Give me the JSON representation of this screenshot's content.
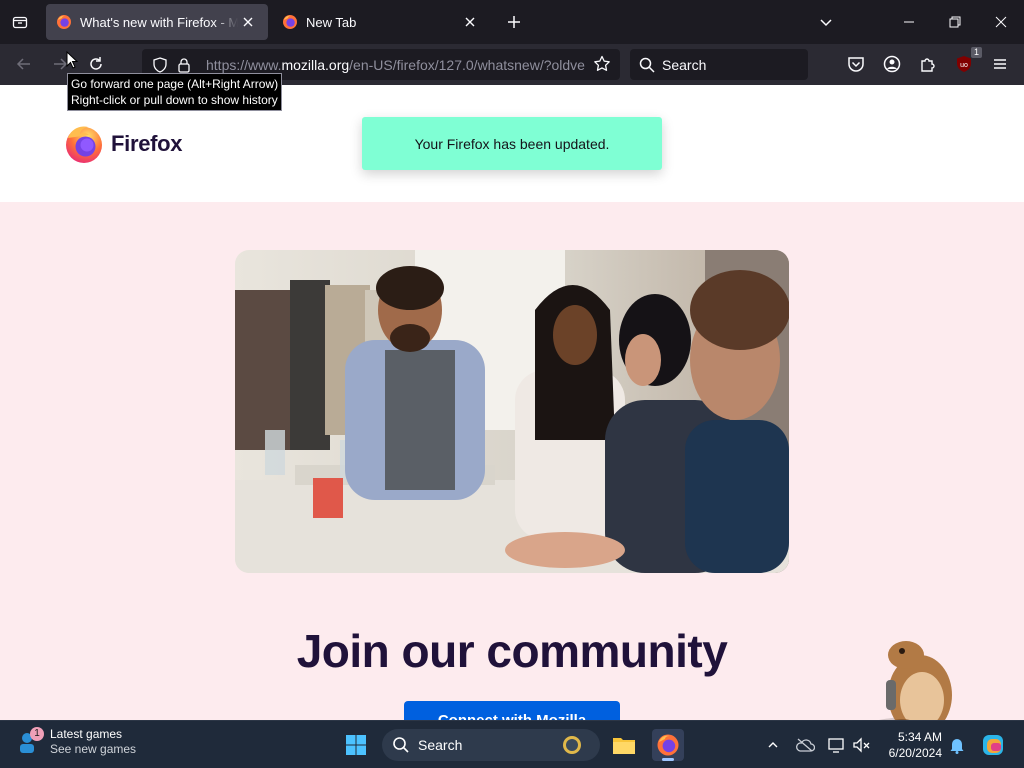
{
  "browser": {
    "tabs": [
      {
        "title": "What's new with Firefox - More",
        "active": true
      },
      {
        "title": "New Tab",
        "active": false
      }
    ],
    "url": {
      "prefix": "https://www.",
      "host": "mozilla.org",
      "path": "/en-US/firefox/127.0/whatsnew/?oldve"
    },
    "search_placeholder": "Search",
    "ublock_count": "1",
    "tooltip": {
      "line1": "Go forward one page (Alt+Right Arrow)",
      "line2": "Right-click or pull down to show history"
    }
  },
  "page": {
    "logo_text": "Firefox",
    "update_notice": "Your Firefox has been updated.",
    "heading": "Join our community",
    "cta_button": "Connect with Mozilla"
  },
  "taskbar": {
    "widget_title": "Latest games",
    "widget_subtitle": "See new games",
    "widget_badge": "1",
    "search_label": "Search",
    "time": "5:34 AM",
    "date": "6/20/2024"
  },
  "colors": {
    "notice_bg": "#7fffd4",
    "hero_bg": "#fdebee",
    "cta_bg": "#0060df",
    "heading_color": "#20123a"
  }
}
